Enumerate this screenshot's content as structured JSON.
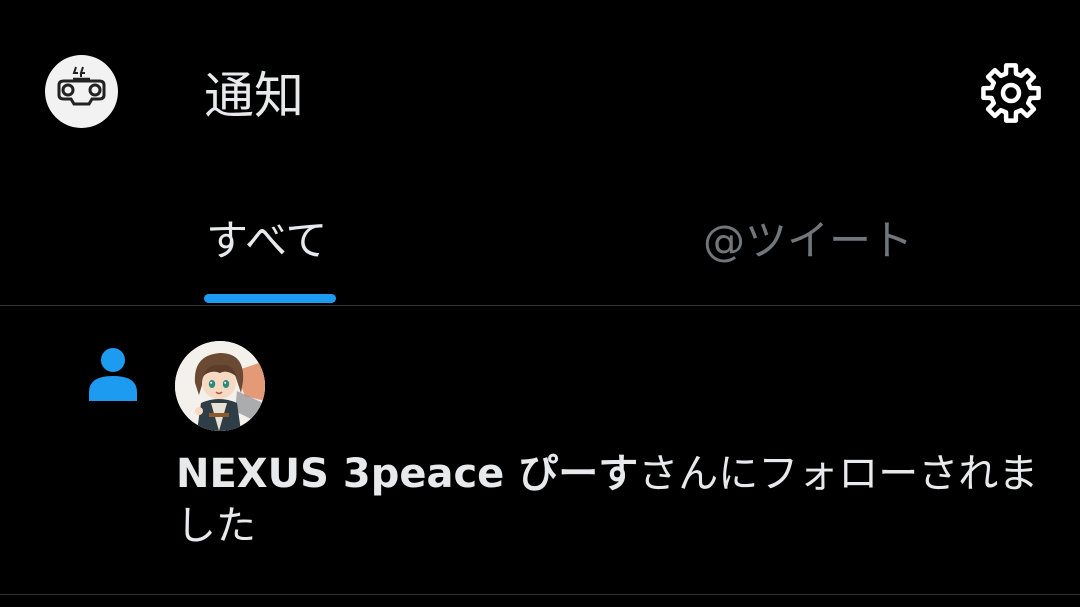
{
  "header": {
    "title": "通知",
    "account_avatar_icon": "robot-face-icon",
    "settings_icon": "gear-icon"
  },
  "tabs": [
    {
      "label": "すべて",
      "selected": true
    },
    {
      "label": "@ツイート",
      "selected": false
    }
  ],
  "notifications": [
    {
      "type": "follow",
      "icon": "person-icon",
      "user_name": "NEXUS 3peace ぴーす",
      "suffix": "さんにフォローされました"
    }
  ],
  "colors": {
    "background": "#000000",
    "accent": "#1d9bf0",
    "text_primary": "#e7e9ea",
    "text_secondary": "#71767b",
    "divider": "#2f3336"
  }
}
